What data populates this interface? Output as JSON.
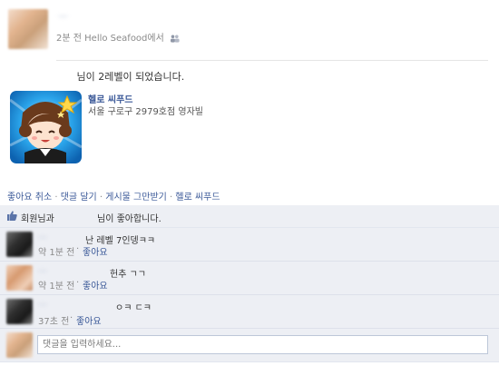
{
  "post": {
    "author": "—",
    "time_ago": "2분 전",
    "via": "Hello Seafood에서",
    "privacy_icon": "friends-icon",
    "message": "님이 2레벨이 되었습니다.",
    "app": {
      "name": "헬로 씨푸드",
      "subtitle": "서울 구로구 2979호점 영자빌"
    }
  },
  "actions": {
    "unlike": "좋아요 취소",
    "comment": "댓글 달기",
    "unfollow": "게시물 그만받기",
    "app_link": "헬로 씨푸드"
  },
  "likes": {
    "text_left": "회원님과",
    "text_right": "님이 좋아합니다."
  },
  "comments": [
    {
      "author": "—",
      "text": "난 레벨 7인뎅ㅋㅋ",
      "time": "약 1분 전",
      "like": "좋아요"
    },
    {
      "author": "—",
      "text": "헌추 ㄱㄱ",
      "time": "약 1분 전",
      "like": "좋아요"
    },
    {
      "author": "—",
      "text": "ㅇㅋ ㄷㅋ",
      "time": "37초 전",
      "like": "좋아요"
    }
  ],
  "comment_input": {
    "placeholder": "댓글을 입력하세요..."
  },
  "colors": {
    "link": "#3b5998",
    "ufi_bg": "#edeff4",
    "meta": "#8a8a8a"
  }
}
